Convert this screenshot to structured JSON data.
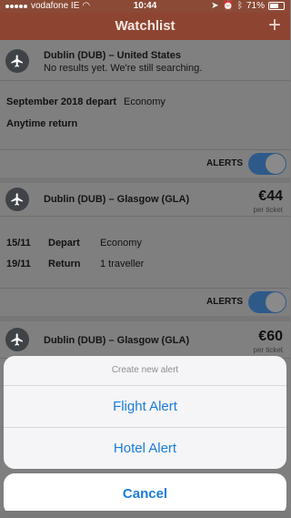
{
  "status_bar": {
    "carrier": "vodafone IE",
    "time": "10:44",
    "battery": "71%"
  },
  "nav": {
    "title": "Watchlist",
    "add_icon": "plus-icon"
  },
  "cards": [
    {
      "route": "Dublin (DUB) – United States",
      "subtitle": "No results yet. We're still searching.",
      "depart_line": "September 2018 depart",
      "cabin": "Economy",
      "return_line": "Anytime return",
      "alerts_label": "ALERTS"
    },
    {
      "route": "Dublin (DUB) – Glasgow (GLA)",
      "price": "€44",
      "per_ticket": "per ticket",
      "rows": [
        {
          "date": "15/11",
          "type": "Depart",
          "info": "Economy"
        },
        {
          "date": "19/11",
          "type": "Return",
          "info": "1 traveller"
        }
      ],
      "alerts_label": "ALERTS"
    },
    {
      "route": "Dublin (DUB) – Glasgow (GLA)",
      "price": "€60",
      "per_ticket": "per ticket"
    }
  ],
  "action_sheet": {
    "title": "Create new alert",
    "options": [
      "Flight Alert",
      "Hotel Alert"
    ],
    "cancel": "Cancel"
  },
  "colors": {
    "accent": "#1a7cd8",
    "nav_bg": "#8d4531",
    "toggle_on": "#2e5a8a"
  }
}
